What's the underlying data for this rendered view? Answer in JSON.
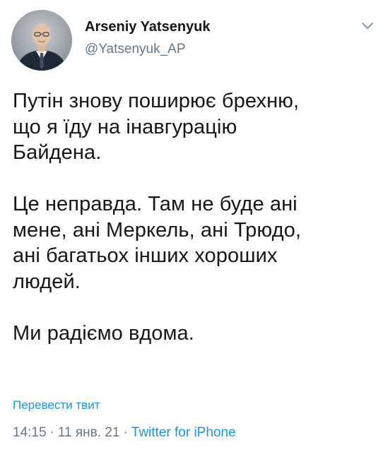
{
  "author": {
    "display_name": "Arseniy Yatsenyuk",
    "handle": "@Yatsenyuk_AP",
    "avatar_icon": "profile-photo"
  },
  "tweet": {
    "text": "Путін знову поширює брехню,\nщо я їду на інавгурацію\nБайдена.\n\nЦе неправда. Там не буде ані\nмене, ані Меркель, ані Трюдо,\nані багатьох інших хороших\nлюдей.\n\nМи радіємо вдома.",
    "translate_label": "Перевести твит",
    "time": "14:15",
    "date": "11 янв. 21",
    "separator": "·",
    "client": "Twitter for iPhone"
  },
  "icons": {
    "menu": "chevron-down-icon"
  },
  "colors": {
    "text": "#14171a",
    "secondary": "#657786",
    "link": "#1b95e0",
    "background": "#ffffff"
  }
}
